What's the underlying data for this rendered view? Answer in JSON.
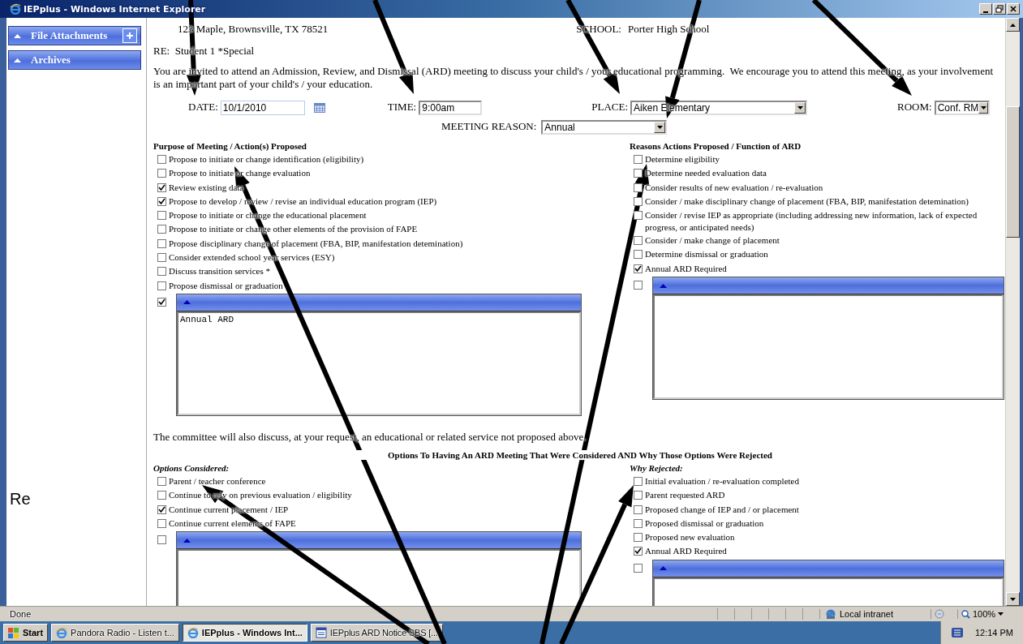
{
  "window": {
    "title": "IEPplus - Windows Internet Explorer"
  },
  "sidebar": {
    "panels": [
      {
        "title": "File Attachments",
        "kind": "add"
      },
      {
        "title": "Archives",
        "kind": "plain"
      }
    ],
    "side_note": "Re"
  },
  "letter": {
    "address": "123 Maple, Brownsville, TX 78521",
    "school_label": "SCHOOL:",
    "school": "Porter High School",
    "re": "RE:  Student 1 *Special",
    "intro": "You are invited to attend an Admission, Review, and Dismissal (ARD) meeting to discuss your child's / your educational programming.  We encourage you to attend this meeting, as your involvement is an important part of your child's / your education."
  },
  "meeting": {
    "date": {
      "label": "DATE:",
      "value": "10/1/2010"
    },
    "time": {
      "label": "TIME:",
      "value": "9:00am"
    },
    "place": {
      "label": "PLACE:",
      "value": "Aiken Elementary"
    },
    "room": {
      "label": "ROOM:",
      "value": "Conf. RM"
    },
    "reason": {
      "label": "MEETING REASON:",
      "value": "Annual"
    }
  },
  "purpose": {
    "title": "Purpose of Meeting / Action(s) Proposed",
    "items": [
      {
        "label": "Propose to initiate or change identification (eligibility)",
        "checked": false
      },
      {
        "label": "Propose to initiate or change evaluation",
        "checked": false
      },
      {
        "label": "Review existing data",
        "checked": true
      },
      {
        "label": "Propose to develop / review / revise an individual education program (IEP)",
        "checked": true
      },
      {
        "label": "Propose to initiate or change the educational placement",
        "checked": false
      },
      {
        "label": "Propose to initiate or change other elements of the provision of FAPE",
        "checked": false
      },
      {
        "label": "Propose disciplinary change of placement (FBA, BIP, manifestation detemination)",
        "checked": false
      },
      {
        "label": "Consider extended school year services (ESY)",
        "checked": false
      },
      {
        "label": "Discuss transition services *",
        "checked": false
      },
      {
        "label": "Propose dismissal or graduation",
        "checked": false
      }
    ],
    "other": {
      "checked": true,
      "notes": "Annual ARD"
    }
  },
  "reasons": {
    "title": "Reasons Actions Proposed / Function of ARD",
    "items": [
      {
        "label": "Determine eligibility",
        "checked": false
      },
      {
        "label": "Determine needed evaluation data",
        "checked": false
      },
      {
        "label": "Consider results of new evaluation / re-evaluation",
        "checked": false
      },
      {
        "label": "Consider / make disciplinary change of placement (FBA, BIP, manifestation detemination)",
        "checked": false
      },
      {
        "label": "Consider / revise IEP as appropriate (including addressing new information, lack of expected progress, or anticipated needs)",
        "checked": false
      },
      {
        "label": "Consider / make change of placement",
        "checked": false
      },
      {
        "label": "Determine dismissal or graduation",
        "checked": false
      },
      {
        "label": "Annual ARD Required",
        "checked": true
      }
    ],
    "other": {
      "checked": false
    }
  },
  "committee_note": "The committee will also discuss, at your request, an educational or related service not proposed above.",
  "options_heading": "Options To Having An ARD Meeting That Were Considered AND Why Those Options Were Rejected",
  "options": {
    "title": "Options Considered:",
    "items": [
      {
        "label": "Parent / teacher conference",
        "checked": false
      },
      {
        "label": "Continue to rely on previous evaluation / eligibility",
        "checked": false
      },
      {
        "label": "Continue current placement / IEP",
        "checked": true
      },
      {
        "label": "Continue current elements of FAPE",
        "checked": false
      }
    ],
    "other": {
      "checked": false
    }
  },
  "rejected": {
    "title": "Why Rejected:",
    "items": [
      {
        "label": "Initial evaluation / re-evaluation completed",
        "checked": false
      },
      {
        "label": "Parent requested ARD",
        "checked": false
      },
      {
        "label": "Proposed change of IEP and / or placement",
        "checked": false
      },
      {
        "label": "Proposed dismissal or graduation",
        "checked": false
      },
      {
        "label": "Proposed new evaluation",
        "checked": false
      },
      {
        "label": "Annual ARD Required",
        "checked": true
      }
    ],
    "other": {
      "checked": false
    }
  },
  "status_bar": {
    "text": "Done",
    "zone": "Local intranet",
    "zoom": "100%"
  },
  "taskbar": {
    "start": "Start",
    "tasks": [
      {
        "label": "Pandora Radio - Listen t...",
        "selected": false,
        "kind": "browser"
      },
      {
        "label": "IEPplus - Windows Int...",
        "selected": true,
        "kind": "browser"
      },
      {
        "label": "IEPplus ARD Notice SBS [...",
        "selected": false,
        "kind": "document"
      }
    ],
    "clock": "12:14 PM"
  }
}
